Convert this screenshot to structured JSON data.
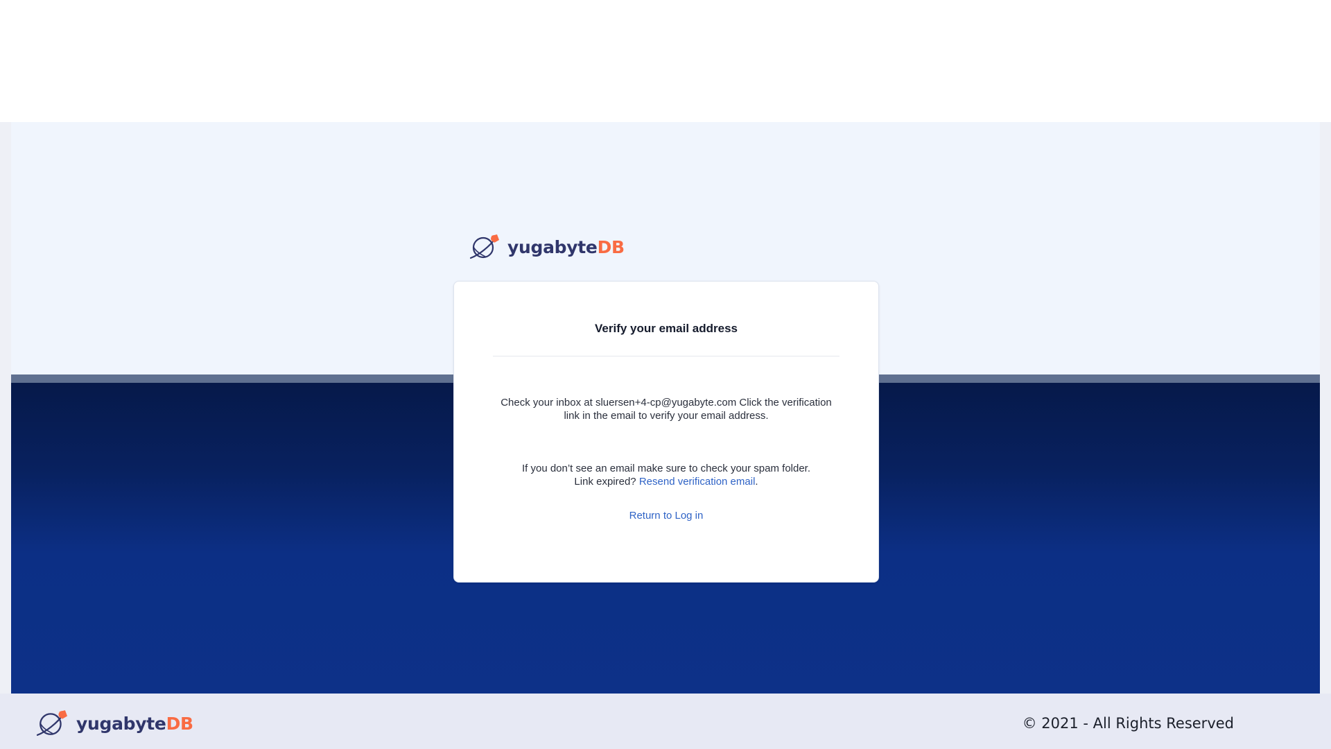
{
  "brand": {
    "name_main": "yugabyte",
    "name_accent": "DB",
    "icon": "yugabyte-planet-icon",
    "colors": {
      "main": "#30366b",
      "accent": "#f96b43"
    }
  },
  "verify_card": {
    "title": "Verify your email address",
    "inbox_message": "Check your inbox at sluersen+4-cp@yugabyte.com Click the verification link in the email to verify your email address.",
    "spam_message": "If you don’t see an email make sure to check your spam folder.",
    "link_expired_prefix": "Link expired?",
    "resend_link": "Resend verification email",
    "resend_suffix": ".",
    "return_link": "Return to Log in",
    "link_color": "#2f63c6"
  },
  "footer": {
    "copyright": "© 2021 - All Rights Reserved"
  }
}
